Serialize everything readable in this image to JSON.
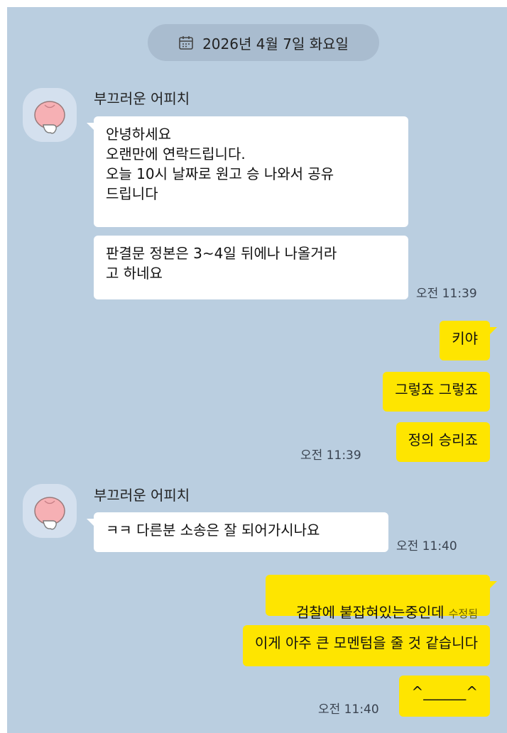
{
  "date_divider": {
    "text": "2026년 4월 7일 화요일",
    "icon": "calendar-icon"
  },
  "colors": {
    "background": "#bacee0",
    "incoming_bubble": "#ffffff",
    "outgoing_bubble": "#fee500",
    "date_pill": "#a9bccf"
  },
  "group1": {
    "sender": "부끄러운 어피치",
    "avatar": "peach-character-avatar",
    "msg1": "안녕하세요\n오랜만에 연락드립니다.\n오늘 10시 날짜로 원고 승 나와서 공유\n드립니다",
    "msg2": "판결문 정본은 3~4일 뒤에나 나올거라\n고 하네요",
    "time": "오전 11:39"
  },
  "group2": {
    "msg1": "키야",
    "msg2": "그렇죠 그렇죠",
    "msg3": "정의 승리죠",
    "time": "오전 11:39"
  },
  "group3": {
    "sender": "부끄러운 어피치",
    "avatar": "peach-character-avatar",
    "msg1": "ㅋㅋ 다른분 소송은 잘 되어가시나요",
    "time": "오전 11:40"
  },
  "group4": {
    "msg1": "검찰에 붙잡혀있는중인데",
    "msg1_edited": "수정됨",
    "msg2": "이게 아주 큰 모멘텀을 줄 것 같습니다",
    "msg3": "^______^",
    "time": "오전 11:40"
  }
}
